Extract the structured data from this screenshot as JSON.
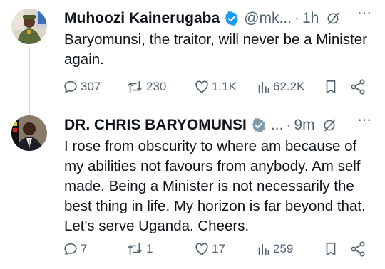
{
  "tweets": [
    {
      "author_name": "Muhoozi Kainerugaba",
      "handle": "@mk...",
      "separator": "·",
      "time": "1h",
      "text": "Baryomunsi, the traitor, will never be a Minister again.",
      "replies": "307",
      "reposts": "230",
      "likes": "1.1K",
      "views": "62.2K",
      "more": "⋯"
    },
    {
      "author_name": "DR. CHRIS BARYOMUNSI",
      "handle": "...",
      "separator": "·",
      "time": "9m",
      "text": "I rose from obscurity to where am because of my abilities not favours from anybody. Am self made.  Being a Minister is not necessarily the best thing in life. My horizon is far beyond that. Let's serve Uganda. Cheers.",
      "replies": "7",
      "reposts": "1",
      "likes": "17",
      "views": "259",
      "more": "⋯"
    }
  ],
  "colors": {
    "text": "#0f1419",
    "secondary": "#536471",
    "verified_blue": "#1d9bf0",
    "verified_gray": "#829aab",
    "thread_line": "#cfd9de"
  },
  "icons": [
    "verified-badge-icon",
    "grok-icon",
    "reply-icon",
    "repost-icon",
    "like-icon",
    "views-icon",
    "bookmark-icon",
    "share-icon",
    "more-icon"
  ]
}
